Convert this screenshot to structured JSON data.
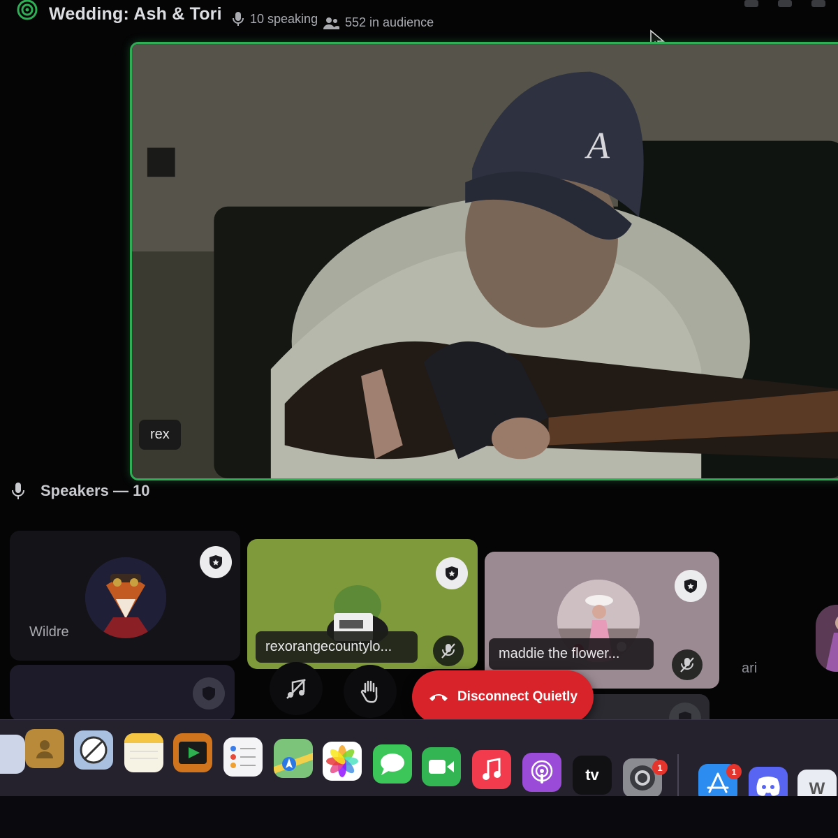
{
  "header": {
    "title": "Wedding: Ash & Tori",
    "speaking": "10 speaking",
    "audience": "552 in audience",
    "stage_icon": "stage-channel-icon"
  },
  "video": {
    "name": "rex",
    "speaking_color": "#2fae55"
  },
  "speakers": {
    "heading": "Speakers — 10",
    "cards": [
      {
        "name": "Wildre",
        "badge": "moderator-shield-icon"
      },
      {
        "name": "rexorangecountylo...",
        "badge": "moderator-shield-icon",
        "status": "muted"
      },
      {
        "name": "maddie the flower...",
        "badge": "moderator-shield-icon",
        "status": "muted"
      },
      {
        "name": "ari"
      }
    ]
  },
  "controls": {
    "music_icon": "music-off-icon",
    "hand_icon": "raise-hand-icon",
    "disconnect": "Disconnect Quietly",
    "disconnect_color": "#d8232a"
  },
  "dock": {
    "apps": [
      "launchpad",
      "contacts",
      "screen-time",
      "notes",
      "media-player",
      "reminders",
      "maps",
      "photos",
      "messages",
      "facetime",
      "music",
      "podcasts",
      "apple-tv",
      "system-settings",
      "app-store",
      "discord",
      "word"
    ],
    "tv_label": "tv",
    "word_label": "W",
    "system_settings_badge": "1",
    "app_store_badge": "1"
  }
}
